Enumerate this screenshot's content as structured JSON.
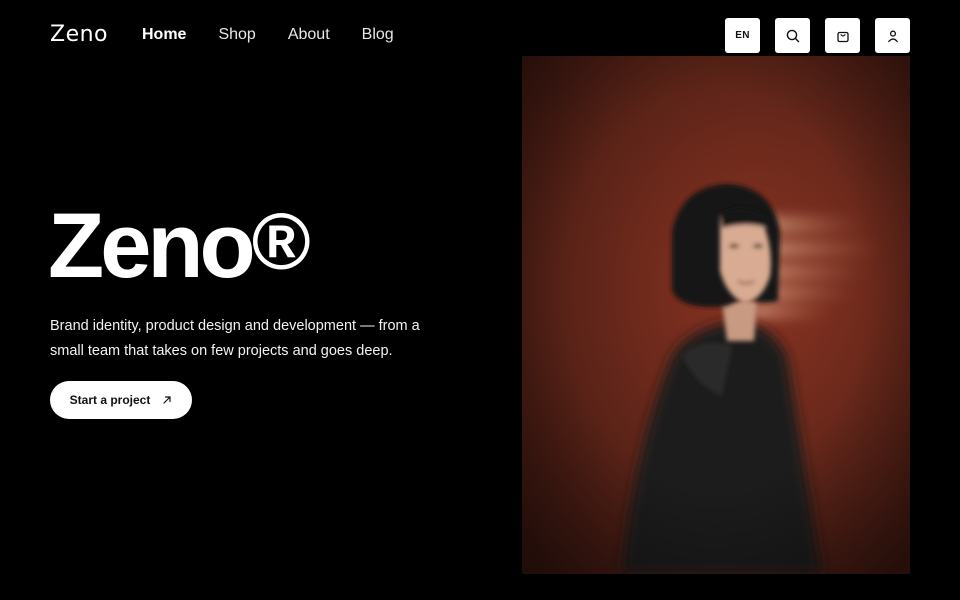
{
  "brand": {
    "logo": "Zeno"
  },
  "nav": {
    "items": [
      {
        "label": "Home",
        "active": true
      },
      {
        "label": "Shop",
        "active": false
      },
      {
        "label": "About",
        "active": false
      },
      {
        "label": "Blog",
        "active": false
      }
    ]
  },
  "header_actions": {
    "language": "EN",
    "icons": [
      "search-icon",
      "shopping-bag-icon",
      "user-icon"
    ]
  },
  "hero": {
    "title": "Zeno",
    "title_mark": "®",
    "description": "Brand identity, product design and development — from a small team that takes on few projects and goes deep.",
    "cta_label": "Start a project",
    "cta_icon": "arrow-up-right-icon"
  },
  "image": {
    "subject": "blurred portrait of a woman with dark bob hair in a black leather jacket against a red background"
  },
  "colors": {
    "background": "#000000",
    "text": "#ffffff",
    "button_bg": "#ffffff",
    "button_text": "#111111",
    "photo_bg": "#6e2a1c"
  }
}
